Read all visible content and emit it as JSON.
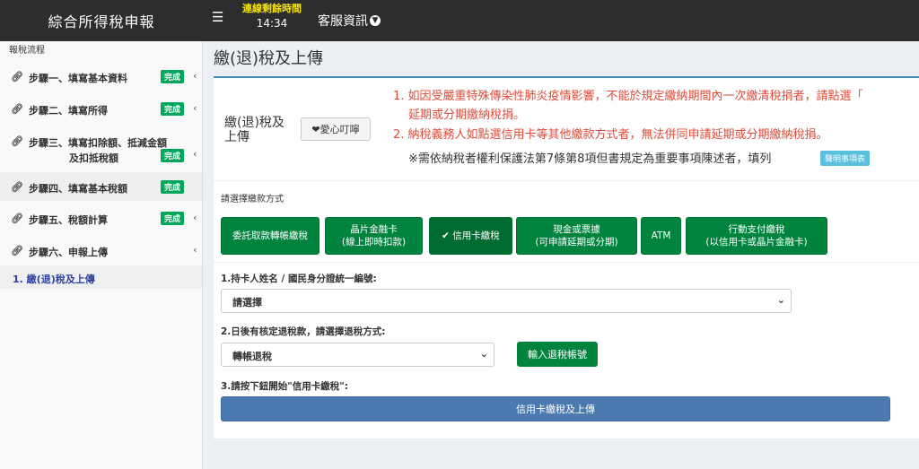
{
  "app": {
    "title": "綜合所得稅申報"
  },
  "topbar": {
    "menu_icon": "hamburger-icon",
    "timer_label": "連線剩餘時間",
    "timer_value": "14:34",
    "service_label": "客服資訊",
    "service_icon": "chevron-circle-down-icon"
  },
  "sidebar": {
    "header": "報稅流程",
    "steps": [
      {
        "label": "步驟一、填寫基本資料",
        "badge": "完成"
      },
      {
        "label": "步驟二、填寫所得",
        "badge": "完成"
      },
      {
        "label": "步驟三、填寫扣除額、抵減金額",
        "label2": "及扣抵稅額",
        "badge": "完成"
      },
      {
        "label": "步驟四、填寫基本稅額",
        "badge": "完成"
      },
      {
        "label": "步驟五、稅額計算",
        "badge": "完成"
      },
      {
        "label": "步驟六、申報上傳",
        "badge": ""
      }
    ],
    "sub_item": "1. 繳(退)稅及上傳",
    "link_icon": "link-icon",
    "chevron": "‹"
  },
  "main": {
    "page_title": "繳(退)稅及上傳",
    "info_title": "繳(退)稅及上傳",
    "info_button": "❤愛心叮嚀",
    "notices": [
      "1. 如因受嚴重特殊傳染性肺炎疫情影響，不能於規定繳納期間內一次繳清稅捐者，請點選「",
      "延期或分期繳納稅捐。",
      "2. 納稅義務人如點選信用卡等其他繳款方式者，無法併同申請延期或分期繳納稅捐。"
    ],
    "note_line": "※需依納稅者權利保護法第7條第8項但書規定為重要事項陳述者，填列",
    "note_tag": "聲明事項表",
    "payment_label": "請選擇繳款方式",
    "payment_methods": [
      {
        "line1": "委託取款轉帳繳稅",
        "line2": ""
      },
      {
        "line1": "晶片金融卡",
        "line2": "(線上即時扣款)"
      },
      {
        "line1": "✔ 信用卡繳稅",
        "line2": ""
      },
      {
        "line1": "現金或票據",
        "line2": "(可申請延期或分期)"
      },
      {
        "line1": "ATM",
        "line2": ""
      },
      {
        "line1": "行動支付繳稅",
        "line2": "(以信用卡或晶片金融卡)"
      }
    ],
    "field1_label": "1.持卡人姓名 / 國民身分證統一編號:",
    "field1_value": "請選擇",
    "field2_label": "2.日後有核定退稅款，請選擇退稅方式:",
    "field2_value": "轉帳退稅",
    "refund_button": "輸入退稅帳號",
    "field3_label": "3.請按下鈕開始\"信用卡繳稅\":",
    "submit_button": "信用卡繳稅及上傳"
  },
  "colors": {
    "topbar": "#2d2d2d",
    "success": "#00a65a",
    "action_green": "#00843d",
    "primary_blue": "#4a7ab0",
    "notice_red": "#dd4b39"
  }
}
